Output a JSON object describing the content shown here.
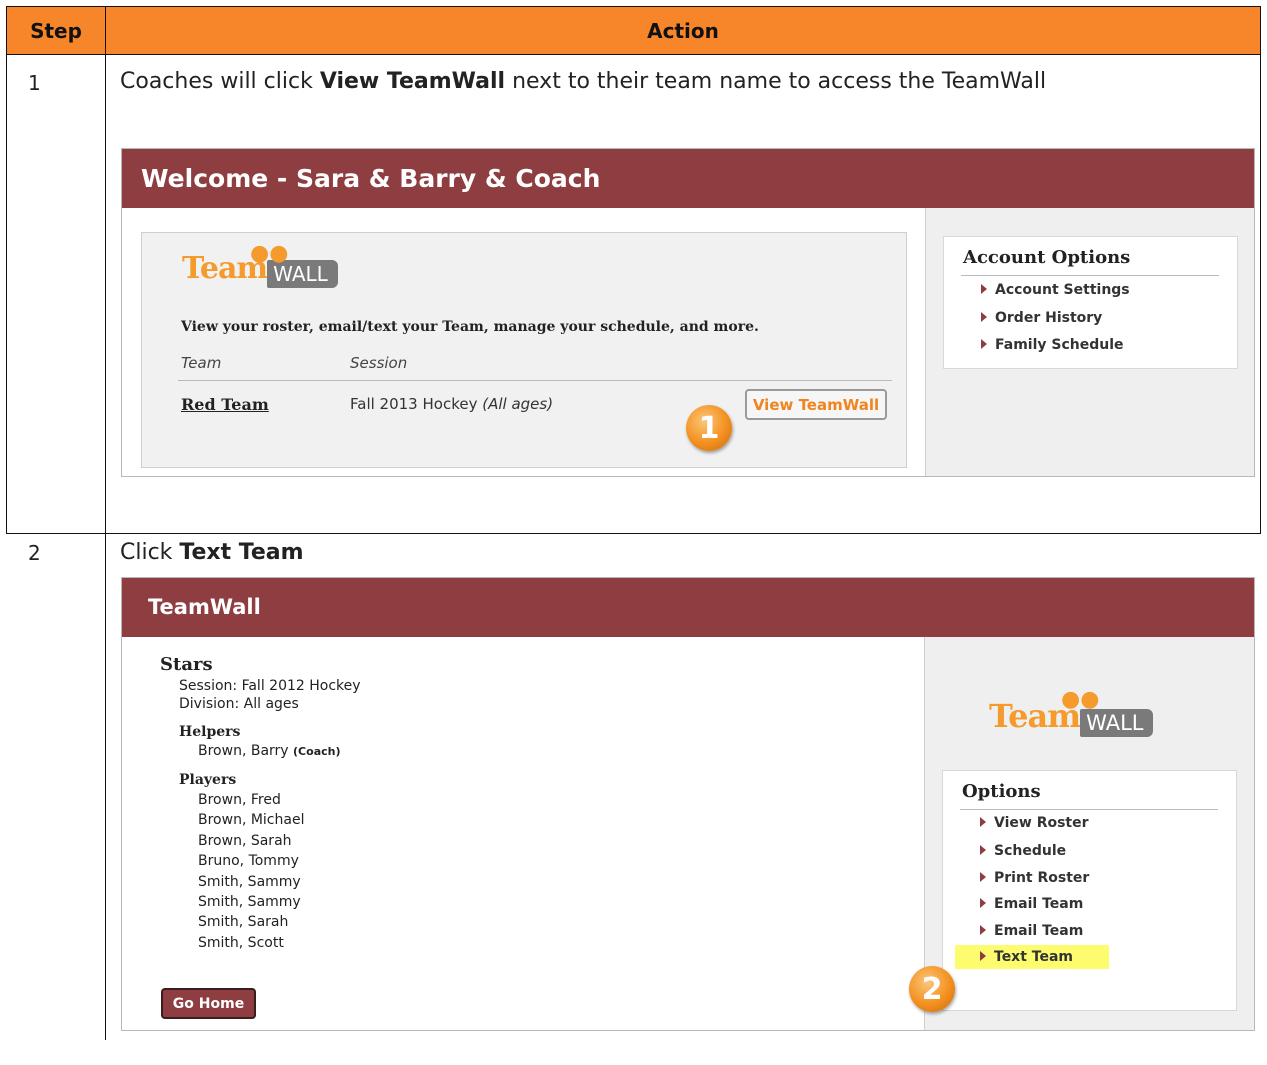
{
  "table": {
    "header_step": "Step",
    "header_action": "Action",
    "rows": [
      {
        "step": "1",
        "instruction_pre": "Coaches will click ",
        "instruction_bold": "View TeamWall",
        "instruction_post": " next to their team name to access the TeamWall"
      },
      {
        "step": "2",
        "instruction_pre": "Click ",
        "instruction_bold": "Text Team",
        "instruction_post": ""
      }
    ]
  },
  "screenshot1": {
    "title": "Welcome - Sara & Barry & Coach",
    "logo_team": "Team",
    "logo_wall": "WALL",
    "description": "View your roster, email/text your Team, manage your schedule, and more.",
    "col_team": "Team",
    "col_session": "Session",
    "team_name": "Red Team",
    "session": "Fall 2013 Hockey",
    "session_note": "(All ages)",
    "view_button": "View TeamWall",
    "badge": "1",
    "account_options_title": "Account Options",
    "account_options": [
      "Account Settings",
      "Order History",
      "Family Schedule"
    ]
  },
  "screenshot2": {
    "title": "TeamWall",
    "team_title": "Stars",
    "session_line": "Session: Fall 2012 Hockey",
    "division_line": "Division: All ages",
    "helpers_label": "Helpers",
    "helper_name": "Brown, Barry",
    "helper_role": "(Coach)",
    "players_label": "Players",
    "players": [
      "Brown, Fred",
      "Brown, Michael",
      "Brown, Sarah",
      "Bruno, Tommy",
      "Smith, Sammy",
      "Smith, Sammy",
      "Smith, Sarah",
      "Smith, Scott"
    ],
    "go_home": "Go Home",
    "logo_team": "Team",
    "logo_wall": "WALL",
    "options_title": "Options",
    "options": [
      "View Roster",
      "Schedule",
      "Print Roster",
      "Email Team",
      "Email Team",
      "Text Team"
    ],
    "badge": "2"
  },
  "colors": {
    "header": "#f7862b",
    "bar": "#8e3e40",
    "highlight": "#fdfc6f",
    "accent": "#f0841f"
  }
}
